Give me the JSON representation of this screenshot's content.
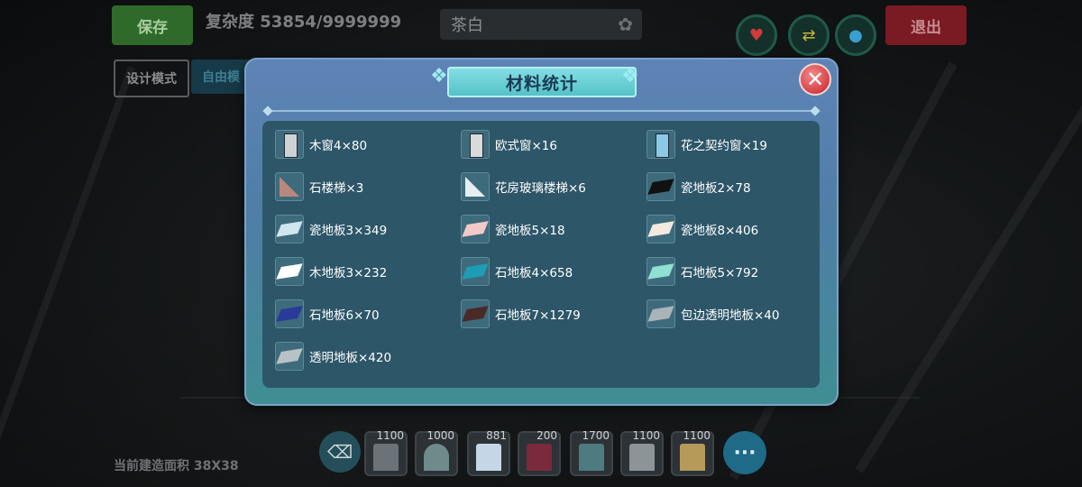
{
  "hud": {
    "save_label": "保存",
    "exit_label": "退出",
    "complexity": "复杂度 53854/9999999",
    "style_name": "茶白",
    "mode_design": "设计模式",
    "mode_free": "自由模",
    "build_area": "当前建造面积 38X38"
  },
  "toolbar": {
    "counts": [
      "1100",
      "1000",
      "881",
      "200",
      "1700",
      "1100",
      "1100"
    ],
    "more_label": "···"
  },
  "modal": {
    "title": "材料统计",
    "close_label": "✕",
    "materials": [
      {
        "label": "木窗4×80",
        "icon": "wood-window-icon",
        "color": "#cfd2d5"
      },
      {
        "label": "欧式窗×16",
        "icon": "european-window-icon",
        "color": "#d8dadc"
      },
      {
        "label": "花之契约窗×19",
        "icon": "flower-window-icon",
        "color": "#8ac9e8"
      },
      {
        "label": "石楼梯×3",
        "icon": "stone-stairs-icon",
        "color": "#b9887c"
      },
      {
        "label": "花房玻璃楼梯×6",
        "icon": "glass-stairs-icon",
        "color": "#e6eef2"
      },
      {
        "label": "瓷地板2×78",
        "icon": "tile-floor-icon",
        "color": "#111111"
      },
      {
        "label": "瓷地板3×349",
        "icon": "tile-floor-icon",
        "color": "#cfe6ee"
      },
      {
        "label": "瓷地板5×18",
        "icon": "tile-floor-icon",
        "color": "#f2c9c9"
      },
      {
        "label": "瓷地板8×406",
        "icon": "tile-floor-icon",
        "color": "#f3e9e1"
      },
      {
        "label": "木地板3×232",
        "icon": "wood-floor-icon",
        "color": "#ffffff"
      },
      {
        "label": "石地板4×658",
        "icon": "stone-floor-icon",
        "color": "#1f9bb5"
      },
      {
        "label": "石地板5×792",
        "icon": "stone-floor-icon",
        "color": "#8fe0d2"
      },
      {
        "label": "石地板6×70",
        "icon": "stone-floor-icon",
        "color": "#2a3a9a"
      },
      {
        "label": "石地板7×1279",
        "icon": "stone-floor-icon",
        "color": "#4a2a26"
      },
      {
        "label": "包边透明地板×40",
        "icon": "transparent-floor-icon",
        "color": "#a9b3b8"
      },
      {
        "label": "透明地板×420",
        "icon": "transparent-floor-icon",
        "color": "#b8c2c6"
      }
    ]
  }
}
